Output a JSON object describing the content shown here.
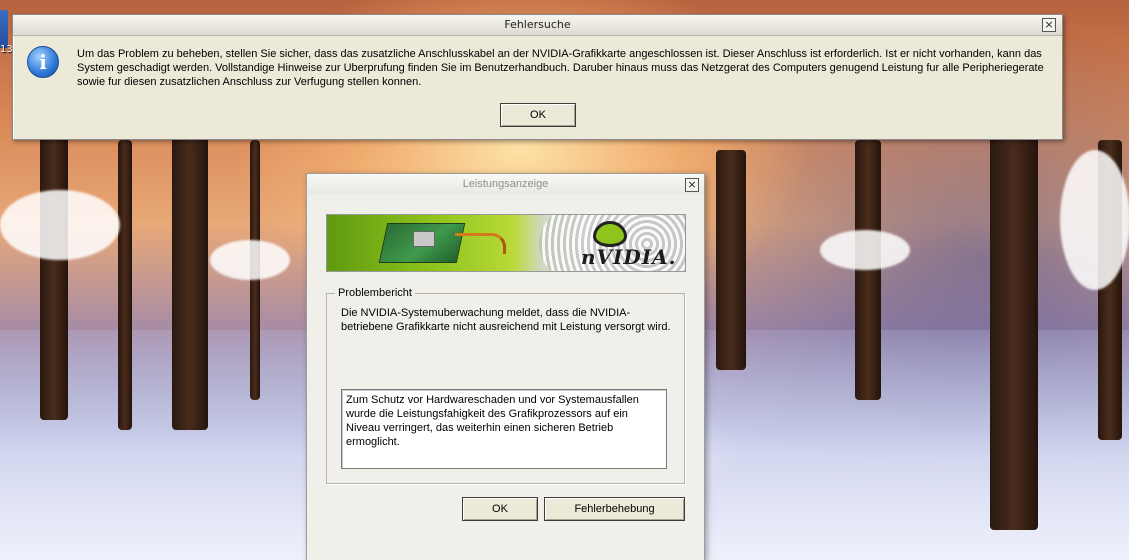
{
  "desktop": {
    "icon_number": "13"
  },
  "error_dialog": {
    "title": "Fehlersuche",
    "close_glyph": "×",
    "info_glyph": "i",
    "message": "Um das Problem zu beheben, stellen Sie sicher, dass das zusatzliche Anschlusskabel an der NVIDIA-Grafikkarte angeschlossen ist. Dieser Anschluss ist erforderlich. Ist er nicht vorhanden, kann das System geschadigt werden. Vollstandige Hinweise zur Uberprufung finden Sie im Benutzerhandbuch. Daruber hinaus muss das Netzgerat des Computers genugend Leistung fur alle Peripheriegerate sowie fur diesen zusatzlichen Anschluss zur Verfugung stellen konnen.",
    "ok_label": "OK"
  },
  "perf_dialog": {
    "title": "Leistungsanzeige",
    "help_glyph": "?",
    "close_glyph": "×",
    "banner_brand": "nVIDIA.",
    "group_label": "Problembericht",
    "summary": "Die NVIDIA-Systemuberwachung meldet, dass die NVIDIA-betriebene Grafikkarte nicht ausreichend mit Leistung versorgt wird.",
    "details": "Zum Schutz vor Hardwareschaden und vor Systemausfallen wurde die Leistungsfahigkeit des Grafikprozessors auf ein Niveau verringert, das weiterhin einen sicheren Betrieb ermoglicht.",
    "ok_label": "OK",
    "fix_label": "Fehlerbehebung"
  }
}
